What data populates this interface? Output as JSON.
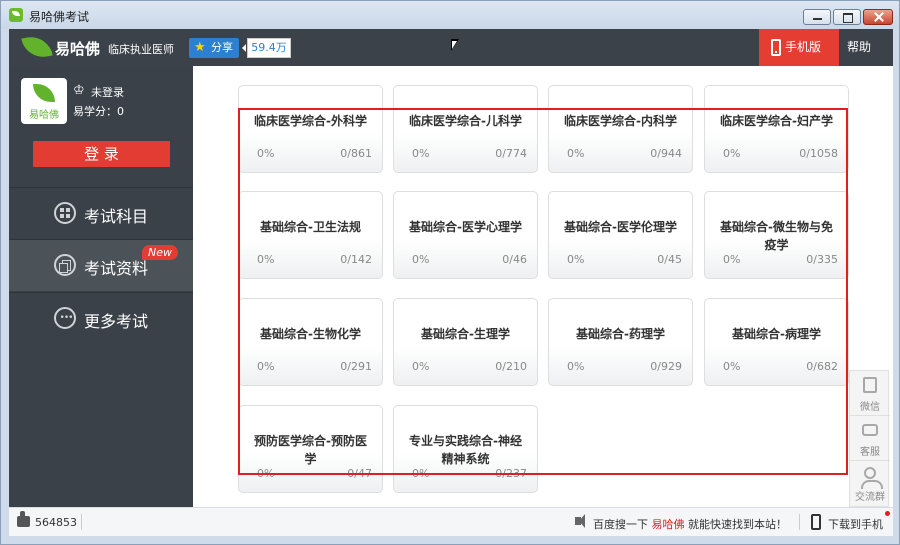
{
  "window": {
    "title": "易哈佛考试"
  },
  "header": {
    "logo_text": "易哈佛",
    "subtitle": "临床执业医师",
    "share_label": "分享",
    "share_count": "59.4万",
    "mobile_label": "手机版",
    "help_label": "帮助"
  },
  "user": {
    "avatar_text": "易哈佛",
    "status": "未登录",
    "points": "易学分：0",
    "login_label": "登 录"
  },
  "nav": [
    {
      "label": "考试科目",
      "active": false
    },
    {
      "label": "考试资料",
      "active": true,
      "badge": "New"
    },
    {
      "label": "更多考试",
      "active": false
    }
  ],
  "cards": [
    {
      "title": "临床医学综合-外科学",
      "progress": "0%",
      "count": "0/861"
    },
    {
      "title": "临床医学综合-儿科学",
      "progress": "0%",
      "count": "0/774"
    },
    {
      "title": "临床医学综合-内科学",
      "progress": "0%",
      "count": "0/944"
    },
    {
      "title": "临床医学综合-妇产学",
      "progress": "0%",
      "count": "0/1058"
    },
    {
      "title": "基础综合-卫生法规",
      "progress": "0%",
      "count": "0/142"
    },
    {
      "title": "基础综合-医学心理学",
      "progress": "0%",
      "count": "0/46"
    },
    {
      "title": "基础综合-医学伦理学",
      "progress": "0%",
      "count": "0/45"
    },
    {
      "title": "基础综合-微生物与免疫学",
      "progress": "0%",
      "count": "0/335"
    },
    {
      "title": "基础综合-生物化学",
      "progress": "0%",
      "count": "0/291"
    },
    {
      "title": "基础综合-生理学",
      "progress": "0%",
      "count": "0/210"
    },
    {
      "title": "基础综合-药理学",
      "progress": "0%",
      "count": "0/929"
    },
    {
      "title": "基础综合-病理学",
      "progress": "0%",
      "count": "0/682"
    },
    {
      "title": "预防医学综合-预防医学",
      "progress": "0%",
      "count": "0/47"
    },
    {
      "title": "专业与实践综合-神经精神系统",
      "progress": "0%",
      "count": "0/237"
    }
  ],
  "float_panel": [
    {
      "label": "微信",
      "icon": "wechat-icon"
    },
    {
      "label": "客服",
      "icon": "chat-icon"
    },
    {
      "label": "交流群",
      "icon": "group-icon"
    }
  ],
  "statusbar": {
    "like_count": "564853",
    "notice_prefix": "百度搜一下",
    "notice_brand": "易哈佛",
    "notice_suffix": "就能快速找到本站！",
    "download_label": "下载到手机"
  },
  "colors": {
    "accent_red": "#e33d33",
    "header_bg": "#3b4249",
    "sidebar_bg": "#3a4148",
    "brand_green": "#63b22b",
    "share_blue": "#2d7fd1"
  }
}
